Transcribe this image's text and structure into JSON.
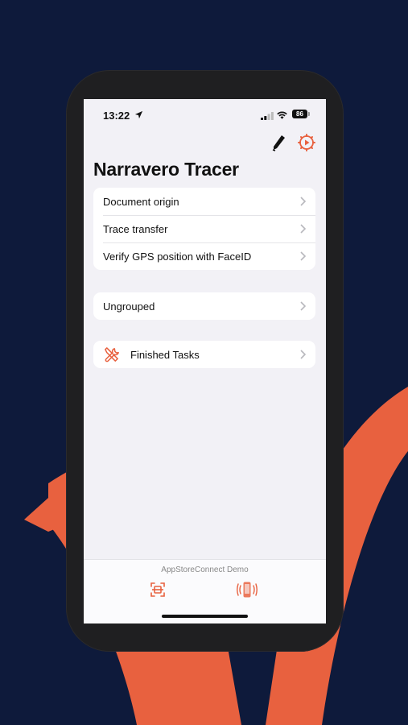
{
  "status_bar": {
    "time": "13:22",
    "battery": "86"
  },
  "header": {
    "title": "Narravero Tracer"
  },
  "groups": [
    {
      "items": [
        {
          "label": "Document origin"
        },
        {
          "label": "Trace transfer"
        },
        {
          "label": "Verify GPS position with FaceID"
        }
      ]
    },
    {
      "items": [
        {
          "label": "Ungrouped"
        }
      ]
    },
    {
      "items": [
        {
          "label": "Finished Tasks",
          "icon": "tools-icon"
        }
      ]
    }
  ],
  "tabbar": {
    "caption": "AppStoreConnect Demo",
    "tabs": [
      {
        "icon": "scan-icon"
      },
      {
        "icon": "phone-vibrate-icon"
      }
    ]
  },
  "colors": {
    "accent": "#e8613f",
    "background": "#0e1a3b",
    "screen_bg": "#f2f1f6"
  }
}
